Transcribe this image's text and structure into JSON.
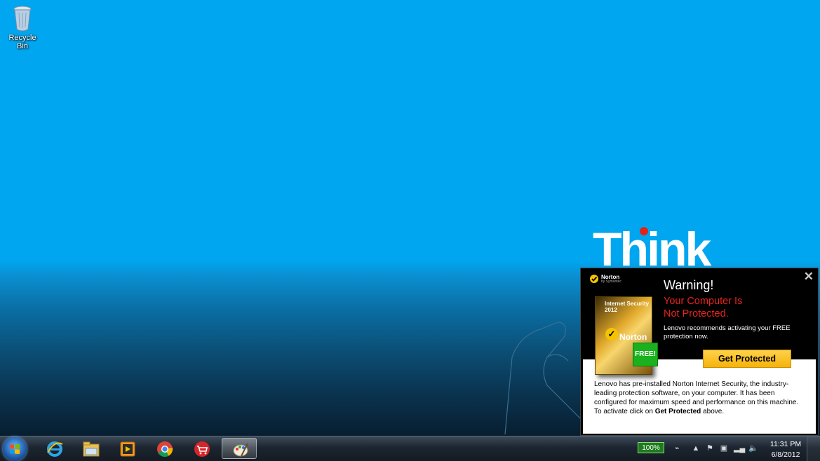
{
  "desktop": {
    "icons": [
      {
        "label": "Recycle Bin",
        "icon": "recycle-bin-icon"
      }
    ],
    "wallpaper_logo": "Think"
  },
  "popup": {
    "brand": "Norton",
    "brand_sub": "by Symantec",
    "product_box_title": "Internet Security 2012",
    "product_box_brand": "Norton",
    "free_badge": "FREE!",
    "heading": "Warning!",
    "alert_line1": "Your Computer Is",
    "alert_line2": "Not Protected.",
    "recommendation": "Lenovo recommends activating your FREE protection now.",
    "cta_label": "Get Protected",
    "body_text_pre": "Lenovo has pre-installed Norton Internet Security, the industry-leading protection software, on your computer. It has been configured for maximum speed and performance on this machine. To activate click on ",
    "body_text_bold": "Get Protected",
    "body_text_post": " above.",
    "colors": {
      "alert": "#e8231d",
      "cta": "#f5b30a",
      "free": "#19b21e"
    }
  },
  "taskbar": {
    "pinned": [
      {
        "name": "internet-explorer-icon"
      },
      {
        "name": "file-explorer-icon"
      },
      {
        "name": "media-player-icon"
      },
      {
        "name": "chrome-icon"
      },
      {
        "name": "shopping-cart-app-icon"
      },
      {
        "name": "paint-app-icon",
        "active": true
      }
    ],
    "tray": {
      "battery": "100%",
      "time": "11:31 PM",
      "date": "6/8/2012"
    }
  }
}
